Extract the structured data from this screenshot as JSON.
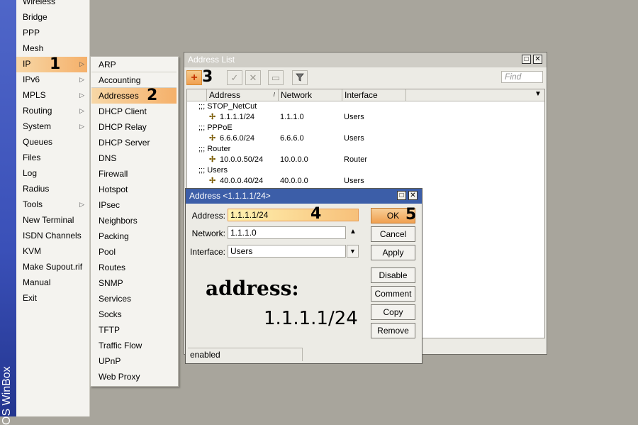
{
  "sidebar_strip": {
    "text": "OS WinBox"
  },
  "main_menu": {
    "items": [
      {
        "label": "Wireless",
        "arrow": false
      },
      {
        "label": "Bridge",
        "arrow": false
      },
      {
        "label": "PPP",
        "arrow": false
      },
      {
        "label": "Mesh",
        "arrow": false
      },
      {
        "label": "IP",
        "arrow": true,
        "active": true
      },
      {
        "label": "IPv6",
        "arrow": true
      },
      {
        "label": "MPLS",
        "arrow": true
      },
      {
        "label": "Routing",
        "arrow": true
      },
      {
        "label": "System",
        "arrow": true
      },
      {
        "label": "Queues",
        "arrow": false
      },
      {
        "label": "Files",
        "arrow": false
      },
      {
        "label": "Log",
        "arrow": false
      },
      {
        "label": "Radius",
        "arrow": false
      },
      {
        "label": "Tools",
        "arrow": true
      },
      {
        "label": "New Terminal",
        "arrow": false
      },
      {
        "label": "ISDN Channels",
        "arrow": false
      },
      {
        "label": "KVM",
        "arrow": false
      },
      {
        "label": "Make Supout.rif",
        "arrow": false
      },
      {
        "label": "Manual",
        "arrow": false
      },
      {
        "label": "Exit",
        "arrow": false
      }
    ]
  },
  "sub_menu": {
    "items": [
      {
        "label": "ARP"
      },
      {
        "label": "Accounting"
      },
      {
        "label": "Addresses",
        "active": true
      },
      {
        "label": "DHCP Client"
      },
      {
        "label": "DHCP Relay"
      },
      {
        "label": "DHCP Server"
      },
      {
        "label": "DNS"
      },
      {
        "label": "Firewall"
      },
      {
        "label": "Hotspot"
      },
      {
        "label": "IPsec"
      },
      {
        "label": "Neighbors"
      },
      {
        "label": "Packing"
      },
      {
        "label": "Pool"
      },
      {
        "label": "Routes"
      },
      {
        "label": "SNMP"
      },
      {
        "label": "Services"
      },
      {
        "label": "Socks"
      },
      {
        "label": "TFTP"
      },
      {
        "label": "Traffic Flow"
      },
      {
        "label": "UPnP"
      },
      {
        "label": "Web Proxy"
      }
    ]
  },
  "badges": {
    "one": "1",
    "two": "2",
    "three": "3",
    "four": "4",
    "five": "5"
  },
  "address_list": {
    "title": "Address List",
    "find_placeholder": "Find",
    "columns": {
      "address": "Address",
      "network": "Network",
      "interface": "Interface"
    },
    "rows": [
      {
        "type": "comment",
        "text": ";;; STOP_NetCut"
      },
      {
        "type": "entry",
        "address": "1.1.1.1/24",
        "network": "1.1.1.0",
        "interface": "Users"
      },
      {
        "type": "comment",
        "text": ";;; PPPoE"
      },
      {
        "type": "entry",
        "address": "6.6.6.0/24",
        "network": "6.6.6.0",
        "interface": "Users"
      },
      {
        "type": "comment",
        "text": ";;; Router"
      },
      {
        "type": "entry",
        "address": "10.0.0.50/24",
        "network": "10.0.0.0",
        "interface": "Router"
      },
      {
        "type": "comment",
        "text": ";;; Users"
      },
      {
        "type": "entry",
        "address": "40.0.0.40/24",
        "network": "40.0.0.0",
        "interface": "Users"
      }
    ]
  },
  "dialog": {
    "title": "Address <1.1.1.1/24>",
    "address_label": "Address:",
    "address_value": "1.1.1.1/24",
    "network_label": "Network:",
    "network_value": "1.1.1.0",
    "interface_label": "Interface:",
    "interface_value": "Users",
    "buttons": {
      "ok": "OK",
      "cancel": "Cancel",
      "apply": "Apply",
      "disable": "Disable",
      "comment": "Comment",
      "copy": "Copy",
      "remove": "Remove"
    },
    "overlay_label": "address:",
    "overlay_value": "1.1.1.1/24",
    "status": "enabled"
  },
  "colors": {
    "highlight": "#f5b06a",
    "title_active": "#3c5ea8",
    "title_inactive": "#cfcdc6"
  }
}
